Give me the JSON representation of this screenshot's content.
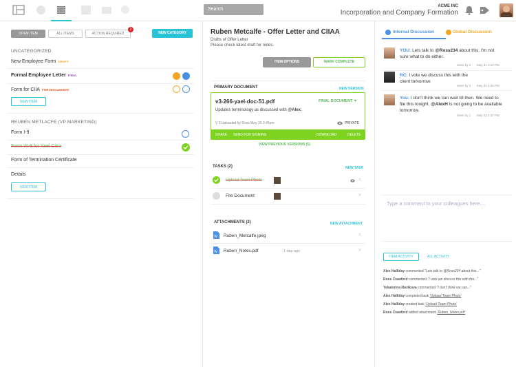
{
  "header": {
    "search_placeholder": "Search",
    "company": "ACME INC",
    "workspace": "Incorporation and Company Formation",
    "nav_icons": [
      "document-stack-icon",
      "clock-icon",
      "list-icon",
      "calendar-icon",
      "mail-icon",
      "gear-icon"
    ],
    "accent": "#27c3d6"
  },
  "left": {
    "tabs": {
      "open": "OPEN ITEM",
      "all": "ALL ITEMS",
      "action": "ACTION REQUIRED",
      "action_count": "2",
      "new_category": "NEW CATEGORY"
    },
    "uncategorized": "UNCATEGORIZED",
    "items1": [
      {
        "label": "New Employee Form",
        "tag": "DRAFT"
      },
      {
        "label": "Formal Employee Letter",
        "tag": "FINAL"
      },
      {
        "label": "Form for CIIA",
        "tag": "FOR DISCUSSION"
      }
    ],
    "new_item": "NEW ITEM",
    "section2": "REUBEN METLACFE (VP MARKETING)",
    "items2": [
      {
        "label": "Form I-9"
      },
      {
        "label": "Form W-9 for Yael Citro"
      },
      {
        "label": "Form of Termination Certificate"
      },
      {
        "label": "Details"
      }
    ],
    "new_item2": "NEW ITEM"
  },
  "mid": {
    "title": "Ruben Metcalfe - Offer Letter and CIIAA",
    "sub1": "Drafts of Offer Letter",
    "sub2": "Please check latest draft for notes.",
    "item_options": "ITEM OPTIONS",
    "mark_complete": "MARK COMPLETE",
    "primary_doc": "PRIMARY DOCUMENT",
    "new_version": "NEW VERSION",
    "doc_name": "v3-266-yael-doc-51.pdf",
    "final_doc": "FINAL DOCUMENT ▼",
    "doc_update_pre": "Updates terminology as discussed with ",
    "doc_update_user": "@Alex.",
    "doc_meta": "V 3 Uploaded by Ross May 26 3.45pm",
    "private": "PRIVATE",
    "share": "SHARE",
    "send_signing": "SEND FOR SIGNING",
    "download": "DOWNLOAD",
    "delete": "DELETE",
    "view_prev": "VIEW PREVIOUS VERSIONS (5)",
    "tasks": "TASKS (2)",
    "new_task": "NEW TASK",
    "task1": "Upload Team Photo",
    "task2": "File Document",
    "attachments": "ATTACHMENTS (2)",
    "new_attachment": "NEW ATTACHMENT",
    "att1": "Ruben_Metcalfe.jpeg",
    "att2": "Ruben_Notes.pdf",
    "att2_time": "1 day ago",
    "x": "X"
  },
  "right": {
    "tab_internal": "Internal Discussion",
    "tab_global": "Global Discussion",
    "messages": [
      {
        "who": "YOU:",
        "pre": "Lets talk to ",
        "mention": "@Ross234",
        "post": " about this. I'm not sure what to do either.",
        "seen": "Seen by 2",
        "time": "May 31 2.34 PM"
      },
      {
        "who": "RC:",
        "pre": "I vote we discuss this with the client tomorrow.",
        "mention": "",
        "post": "",
        "seen": "Seen by 3",
        "time": "May 31 2.35 PM"
      },
      {
        "who": "You:",
        "pre": "I don't think we can wait till then. We need to file this tonight. ",
        "mention": "@AlexH",
        "post": " is not going to be available tomorrow.",
        "seen": "Seen by 1",
        "time": "May 31 2.37 PM"
      }
    ],
    "comment_placeholder": "Type a comment to your colleagues here....",
    "item_activity": "ITEM ACTIVITY",
    "all_activity": "ALL ACTIVITY",
    "activity": [
      {
        "who": "Alex Halliday",
        "what": " commented ",
        "detail": "\"Lets talk to @Ross234 about this...\""
      },
      {
        "who": "Ross Crawford",
        "what": " commented ",
        "detail": "\"I vote we discuss this with the...\""
      },
      {
        "who": "Yekaterina Novikova",
        "what": " commented ",
        "detail": "\"I don't think we can...\""
      },
      {
        "who": "Alex Halliday",
        "what": " completed task ",
        "detail": "'Upload Team Photo'"
      },
      {
        "who": "Alex Halliday",
        "what": " created task ",
        "detail": "'Upload Team Photo'"
      },
      {
        "who": "Ross Crawford",
        "what": " added attachment ",
        "detail": "'Ruben_Notes.pdf'"
      }
    ]
  }
}
